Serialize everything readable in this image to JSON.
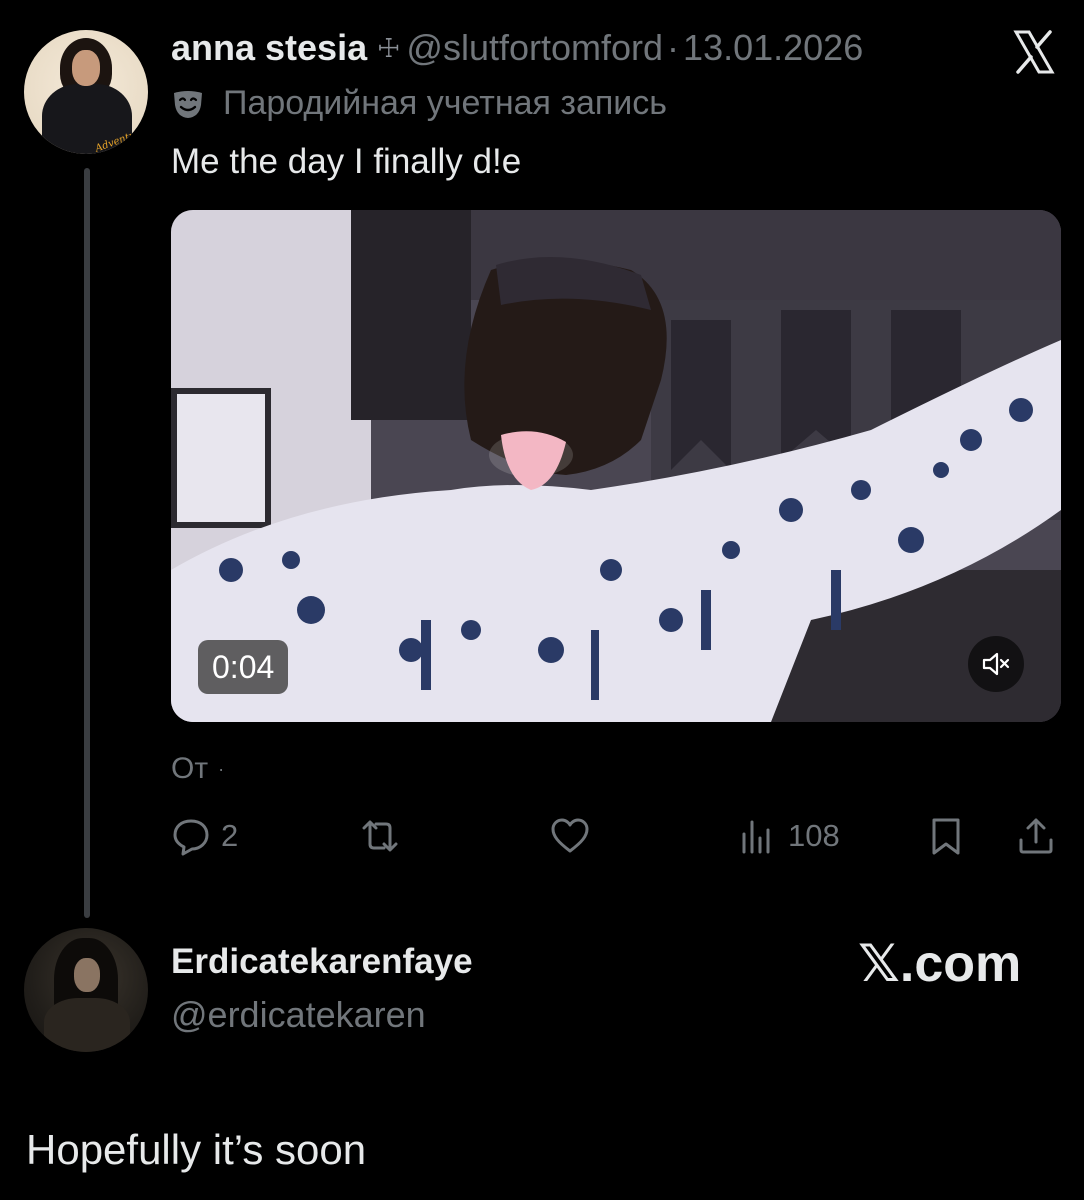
{
  "tweet": {
    "author": {
      "display_name": "anna stesia",
      "name_glyph": "☩",
      "handle": "@slutfortomford",
      "avatar_logo_text": "Adventures"
    },
    "separator": "·",
    "date": "13.01.2026",
    "parody_label": "Пародийная учетная запись",
    "text": "Me the day I finally d!e",
    "video": {
      "duration": "0:04",
      "muted": true
    },
    "source_label": "От",
    "source_dot": "·",
    "actions": {
      "replies": "2",
      "retweets": "",
      "likes": "",
      "views": "108"
    }
  },
  "reply_user": {
    "display_name": "Erdicatekarenfaye",
    "handle": "@erdicatekaren"
  },
  "watermark": "𝕏.com",
  "reply_text": "Hopefully it’s soon",
  "icons": {
    "platform": "x-logo-icon",
    "parody": "mask-icon",
    "mute": "mute-icon",
    "reply": "reply-icon",
    "retweet": "retweet-icon",
    "like": "heart-icon",
    "views": "views-icon",
    "bookmark": "bookmark-icon",
    "share": "share-icon"
  },
  "colors": {
    "background": "#000000",
    "primary_text": "#e7e9ea",
    "secondary_text": "#71767b",
    "thread_line": "#3a3d41"
  }
}
